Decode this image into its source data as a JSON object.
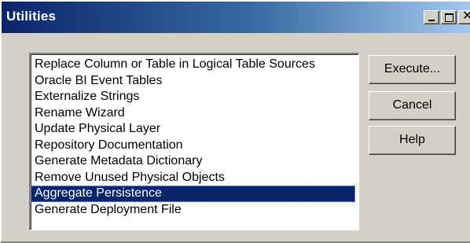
{
  "window": {
    "title": "Utilities",
    "controls": {
      "minimize": "minimize-icon",
      "maximize": "maximize-icon",
      "close": "close-icon"
    }
  },
  "list": {
    "items": [
      "Replace Column or Table in Logical Table Sources",
      "Oracle BI Event Tables",
      "Externalize Strings",
      "Rename Wizard",
      "Update Physical Layer",
      "Repository Documentation",
      "Generate Metadata Dictionary",
      "Remove Unused Physical Objects",
      "Aggregate Persistence",
      "Generate Deployment File"
    ],
    "selected": "Aggregate Persistence"
  },
  "buttons": {
    "execute": "Execute...",
    "cancel": "Cancel",
    "help": "Help"
  },
  "colors": {
    "title_bar": "#0a246a",
    "selection": "#0a246a",
    "dialog_face": "#d4d0c8"
  }
}
